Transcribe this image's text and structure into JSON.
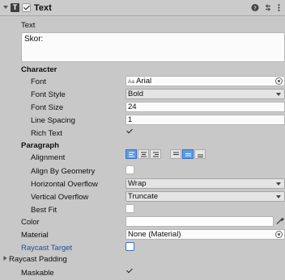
{
  "component": {
    "title": "Text",
    "enabled": true,
    "icon_name": "text-component-icon"
  },
  "text_section": {
    "label": "Text",
    "value": "Skor:"
  },
  "character": {
    "heading": "Character",
    "font_label": "Font",
    "font_prefix": "Aa",
    "font_value": "Arial",
    "font_style_label": "Font Style",
    "font_style_value": "Bold",
    "font_size_label": "Font Size",
    "font_size_value": "24",
    "line_spacing_label": "Line Spacing",
    "line_spacing_value": "1",
    "rich_text_label": "Rich Text",
    "rich_text_checked": true
  },
  "paragraph": {
    "heading": "Paragraph",
    "alignment_label": "Alignment",
    "align_by_geometry_label": "Align By Geometry",
    "align_by_geometry_checked": false,
    "horizontal_overflow_label": "Horizontal Overflow",
    "horizontal_overflow_value": "Wrap",
    "vertical_overflow_label": "Vertical Overflow",
    "vertical_overflow_value": "Truncate",
    "best_fit_label": "Best Fit",
    "best_fit_checked": false
  },
  "color_label": "Color",
  "color_value": "#ffffff",
  "material_label": "Material",
  "material_value": "None (Material)",
  "raycast_target_label": "Raycast Target",
  "raycast_target_checked": false,
  "raycast_padding_label": "Raycast Padding",
  "maskable_label": "Maskable",
  "maskable_checked": true,
  "colors": {
    "header_bg": "#cbcbcb",
    "panel_bg": "#c8c8c8",
    "accent": "#3a72c8",
    "highlight_label": "#1d4f9b"
  }
}
